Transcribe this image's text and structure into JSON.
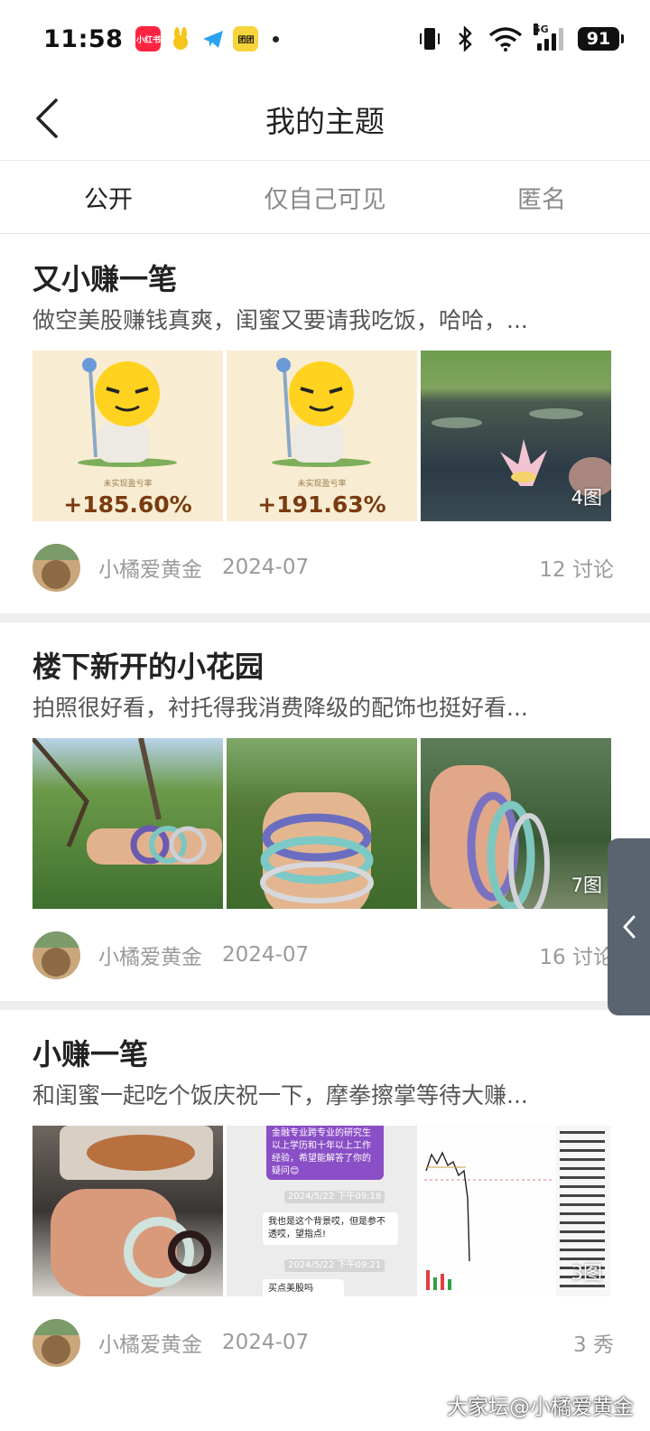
{
  "status_bar": {
    "time": "11:58",
    "apps": [
      "小红书",
      "",
      "",
      "团团"
    ],
    "network": "5G",
    "battery": "91"
  },
  "header": {
    "title": "我的主题",
    "back_icon": "chevron-left-icon"
  },
  "tabs": [
    {
      "label": "公开",
      "active": true
    },
    {
      "label": "仅自己可见",
      "active": false
    },
    {
      "label": "匿名",
      "active": false
    }
  ],
  "posts": [
    {
      "title": "又小赚一笔",
      "summary": "做空美股赚钱真爽，闺蜜又要请我吃饭，哈哈，...",
      "image_count": "4图",
      "thumb_text": {
        "label_1": "未实现盈亏率",
        "pct_1": "+185.60%",
        "label_2": "未实现盈亏率",
        "pct_2": "+191.63%"
      },
      "author": "小橘爱黄金",
      "date": "2024-07",
      "comments": "12 讨论"
    },
    {
      "title": "楼下新开的小花园",
      "summary": "拍照很好看，衬托得我消费降级的配饰也挺好看...",
      "image_count": "7图",
      "author": "小橘爱黄金",
      "date": "2024-07",
      "comments": "16 讨论"
    },
    {
      "title": "小赚一笔",
      "summary": "和闺蜜一起吃个饭庆祝一下，摩拳擦掌等待大赚...",
      "image_count": "3图",
      "chat_text": {
        "msg_1": "金融专业跨专业的研究生以上学历和十年以上工作经验，希望能解答了你的疑问😊",
        "time_1": "2024/5/22 下午09:18",
        "msg_2": "我也是这个背景哎，但是参不透哎，望指点!",
        "time_2": "2024/5/22 下午09:21",
        "msg_3": "买点美股吗"
      },
      "author": "小橘爱黄金",
      "date": "2024-07",
      "comments": "3 秀"
    }
  ],
  "watermark": "大家坛@小橘爱黄金",
  "colors": {
    "accent_text": "#222222",
    "muted_text": "#9a9a9a",
    "separator": "#eeeeee",
    "side_tab": "#5a6470"
  }
}
